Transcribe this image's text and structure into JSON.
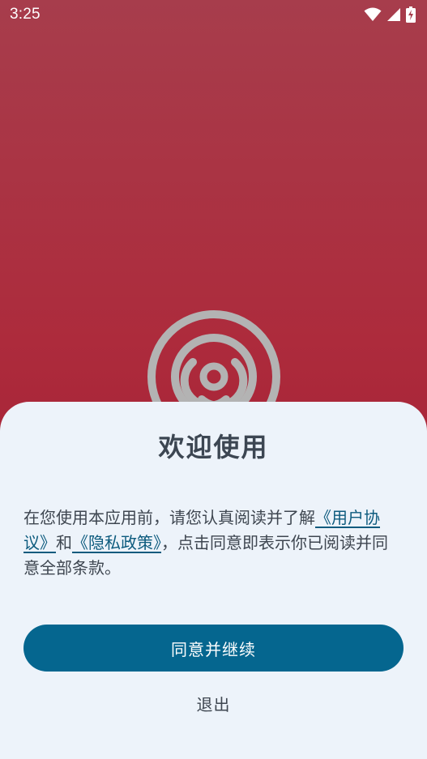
{
  "status_bar": {
    "time": "3:25",
    "icons": [
      "wifi-icon",
      "cell-signal-icon",
      "battery-charging-icon"
    ]
  },
  "app": {
    "logo_icon": "target-rings-logo",
    "background_color_top": "#a73d4c",
    "background_color_bottom": "#9e2033"
  },
  "dialog": {
    "title": "欢迎使用",
    "body_prefix": "在您使用本应用前，请您认真阅读并了解",
    "user_agreement_link": "《用户协议》",
    "and_text": "和",
    "privacy_policy_link": "《隐私政策》",
    "body_suffix": "，点击同意即表示你已阅读并同意全部条款。",
    "agree_button_label": "同意并继续",
    "exit_button_label": "退出",
    "accent_color": "#05668f",
    "background_color": "#edf3fa"
  }
}
